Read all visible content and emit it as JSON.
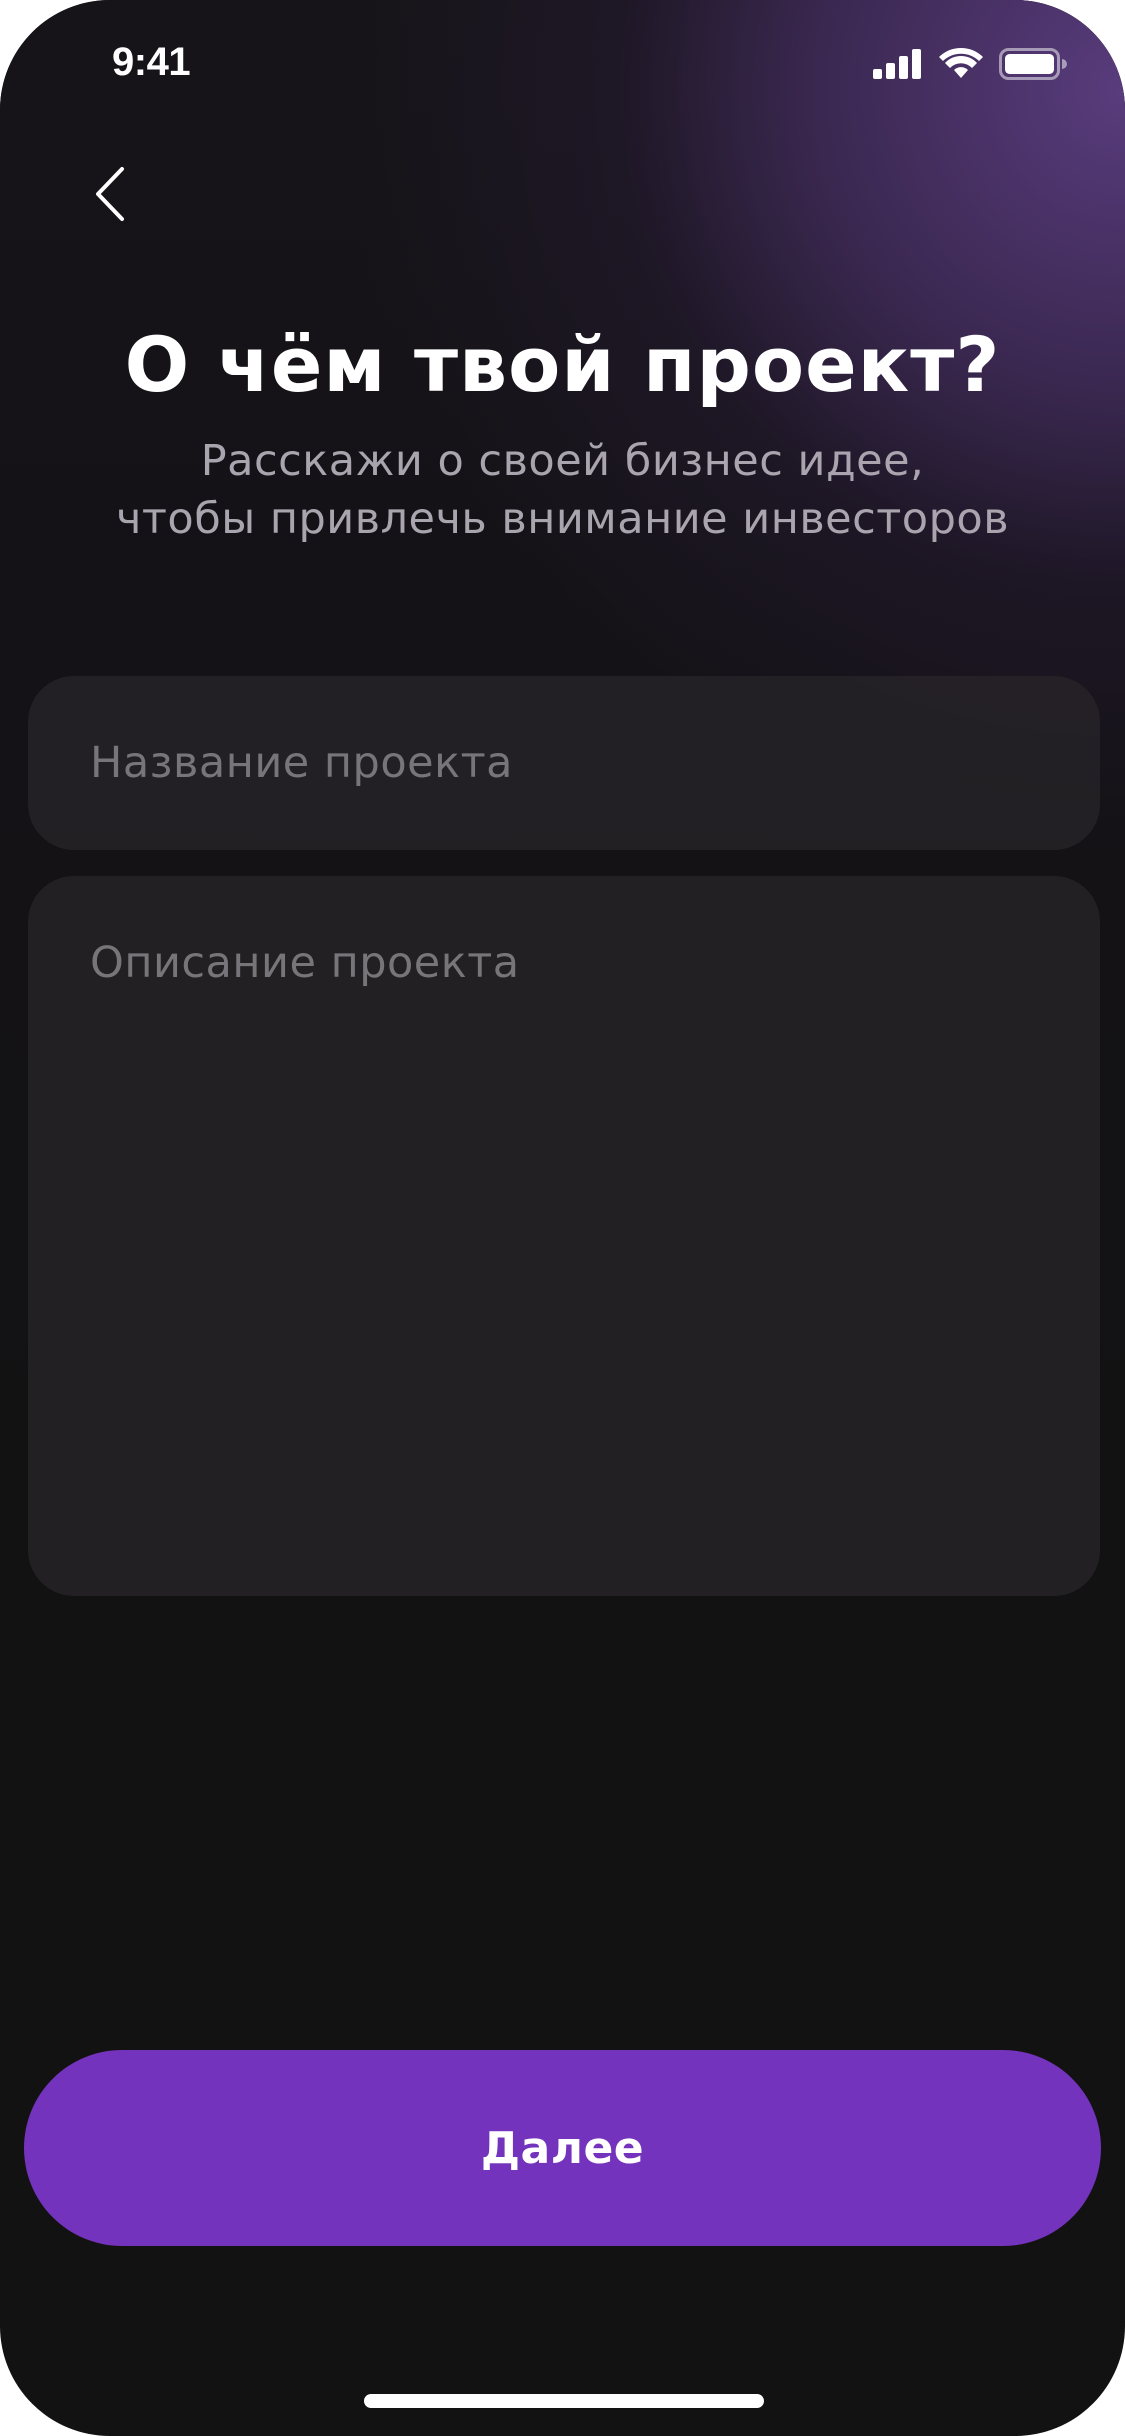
{
  "status_bar": {
    "time": "9:41",
    "icons": [
      "cellular-signal-icon",
      "wifi-icon",
      "battery-icon"
    ]
  },
  "header": {
    "back_icon": "chevron-left-icon",
    "title": "О чём твой проект?",
    "subtitle_line1": "Расскажи о своей бизнес идее,",
    "subtitle_line2": "чтобы привлечь внимание инвесторов"
  },
  "form": {
    "name_field": {
      "value": "",
      "placeholder": "Название проекта"
    },
    "description_field": {
      "value": "",
      "placeholder": "Описание проекта"
    }
  },
  "footer": {
    "next_label": "Далее"
  },
  "colors": {
    "accent": "#7433bc",
    "background": "#121212",
    "glow": "#5c3e82",
    "field_bg": "#28262a",
    "placeholder": "#77757a",
    "subtitle": "#a9a4ad"
  }
}
